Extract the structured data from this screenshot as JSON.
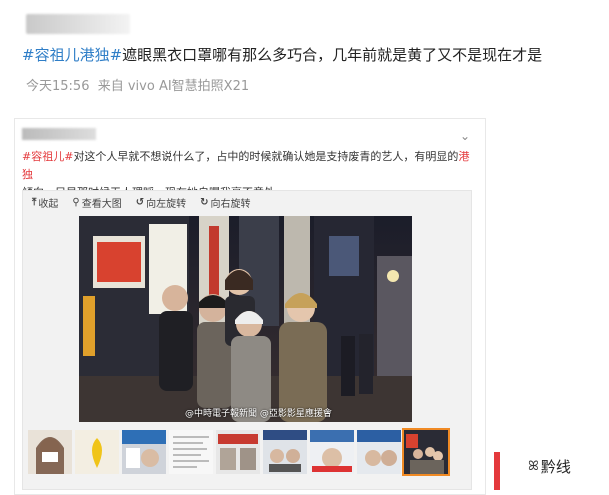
{
  "post": {
    "hashtag": "#容祖儿港独#",
    "headline_rest": "遮眼黑衣口罩哪有那么多巧合，几年前就是黄了又不是现在才是",
    "time": "今天15:56",
    "source": "来自 vivo AI智慧拍照X21"
  },
  "quoted": {
    "tag1": "#容祖儿#",
    "text1": "对这个人早就不想说什么了，占中的时候就确认她是支持废青的艺人，有明显的",
    "tag2": "港独",
    "text2": "倾向，只是那时候无人理睬，现在她自曝我毫不意外。",
    "toolbar": [
      "收起",
      "查看大图",
      "向左旋转",
      "向右旋转"
    ],
    "watermark": "@中時電子報新聞 @亞影影星應援會"
  },
  "logo": {
    "text": "黔线"
  },
  "colors": {
    "link_blue": "#2f7ec7",
    "tag_red": "#e4393c",
    "selected_thumb": "#f08a24"
  }
}
